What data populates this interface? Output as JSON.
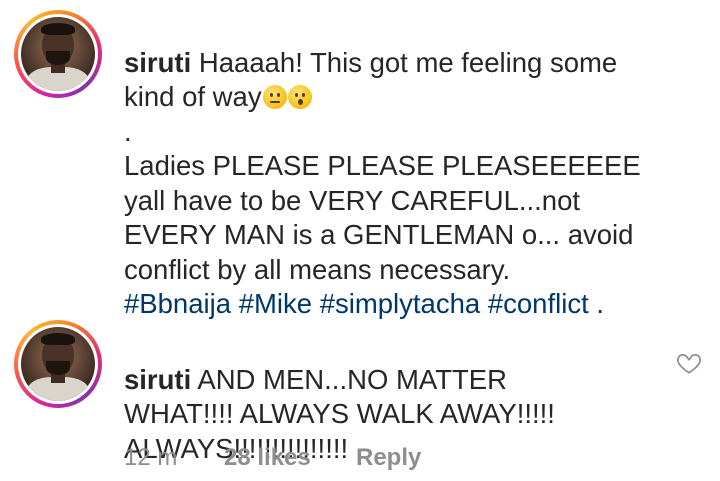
{
  "comments": [
    {
      "username": "siruti",
      "line1": " Haaaah! This got me feeling some",
      "line2": "kind of way",
      "emojis": [
        "confused-face-emoji",
        "hushed-face-emoji"
      ],
      "line3": ".",
      "body": "Ladies PLEASE PLEASE PLEASEEEEEE\nyall have to be VERY CAREFUL...not\nEVERY MAN is a GENTLEMAN o... avoid\nconflict by all means necessary.",
      "hashtags": [
        "#Bbnaija",
        "#Mike",
        "#simplytacha",
        "#conflict"
      ],
      "trailing": " ."
    },
    {
      "username": "siruti",
      "text": " AND MEN...NO MATTER\nWHAT!!!! ALWAYS WALK AWAY!!!!!\nALWAYS!!!!!!!!!!!!!!!",
      "time": "12 m",
      "likes": "28 likes",
      "reply": "Reply",
      "like_icon": "heart-outline-icon"
    }
  ]
}
